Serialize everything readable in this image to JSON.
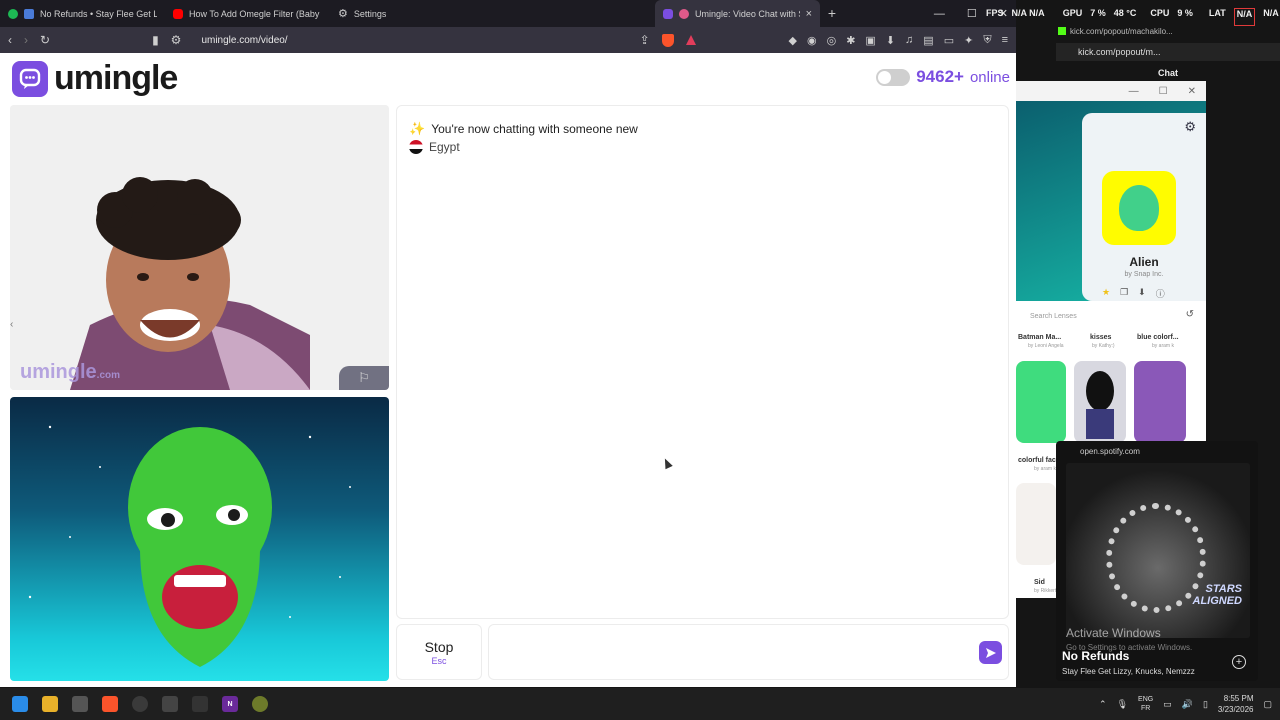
{
  "browser": {
    "tabs": [
      {
        "title": "No Refunds • Stay Flee Get Lizzy",
        "favicon_color": "#1db954",
        "active": false
      },
      {
        "title": "How To Add Omegle Filter (Baby Fac",
        "favicon_color": "#ff0000",
        "active": false
      },
      {
        "title": "Settings",
        "favicon_color": "#9aa0a6",
        "active": false
      },
      {
        "title": "Umingle: Video Chat with Str",
        "favicon_color": "#7b4ee0",
        "active": true
      }
    ],
    "new_tab": "+",
    "url": "umingle.com/video/"
  },
  "site": {
    "logo_text": "umingle",
    "online_count": "9462+",
    "online_label": "online",
    "accent_color": "#7b4ee0",
    "watermark_main": "umingle",
    "watermark_suffix": ".com"
  },
  "chat": {
    "status_message": "You're now chatting with someone new",
    "country": "Egypt",
    "message_placeholder": ""
  },
  "controls": {
    "stop_label": "Stop",
    "stop_key": "Esc"
  },
  "sysmon": {
    "fps_label": "FPS",
    "fps_value": "N/A N/A",
    "gpu_label": "GPU",
    "gpu_value": "7 %",
    "gpu_temp": "48 °C",
    "cpu_label": "CPU",
    "cpu_value": "9 %",
    "lat_label": "LAT",
    "lat_value_1": "N/A",
    "lat_value_2": "N/A"
  },
  "kick": {
    "window_title": "kick.com/popout/machakilo...",
    "url": "kick.com/popout/m...",
    "chat_title": "Chat"
  },
  "snap": {
    "lens_name": "Alien",
    "lens_by": "by Snap Inc.",
    "search_placeholder": "Search Lenses",
    "lenses": [
      {
        "name": "Batman Ma...",
        "by": "by Leoni Angela"
      },
      {
        "name": "kisses",
        "by": "by Kathy:)"
      },
      {
        "name": "blue colorf...",
        "by": "by aram k"
      },
      {
        "name": "colorful fac",
        "by": "by aram k"
      },
      {
        "name": "Sid",
        "by": "by Rikkert"
      }
    ]
  },
  "spotify": {
    "url": "open.spotify.com",
    "track": "No Refunds",
    "artists": "Stay Flee Get Lizzy, Knucks, Nemzzz",
    "album_text": "STARS ALIGNED"
  },
  "windows": {
    "activate_title": "Activate Windows",
    "activate_sub": "Go to Settings to activate Windows."
  },
  "taskbar": {
    "lang_1": "ENG",
    "lang_2": "FR",
    "time": "8:55 PM",
    "date": "3/23/2026"
  }
}
